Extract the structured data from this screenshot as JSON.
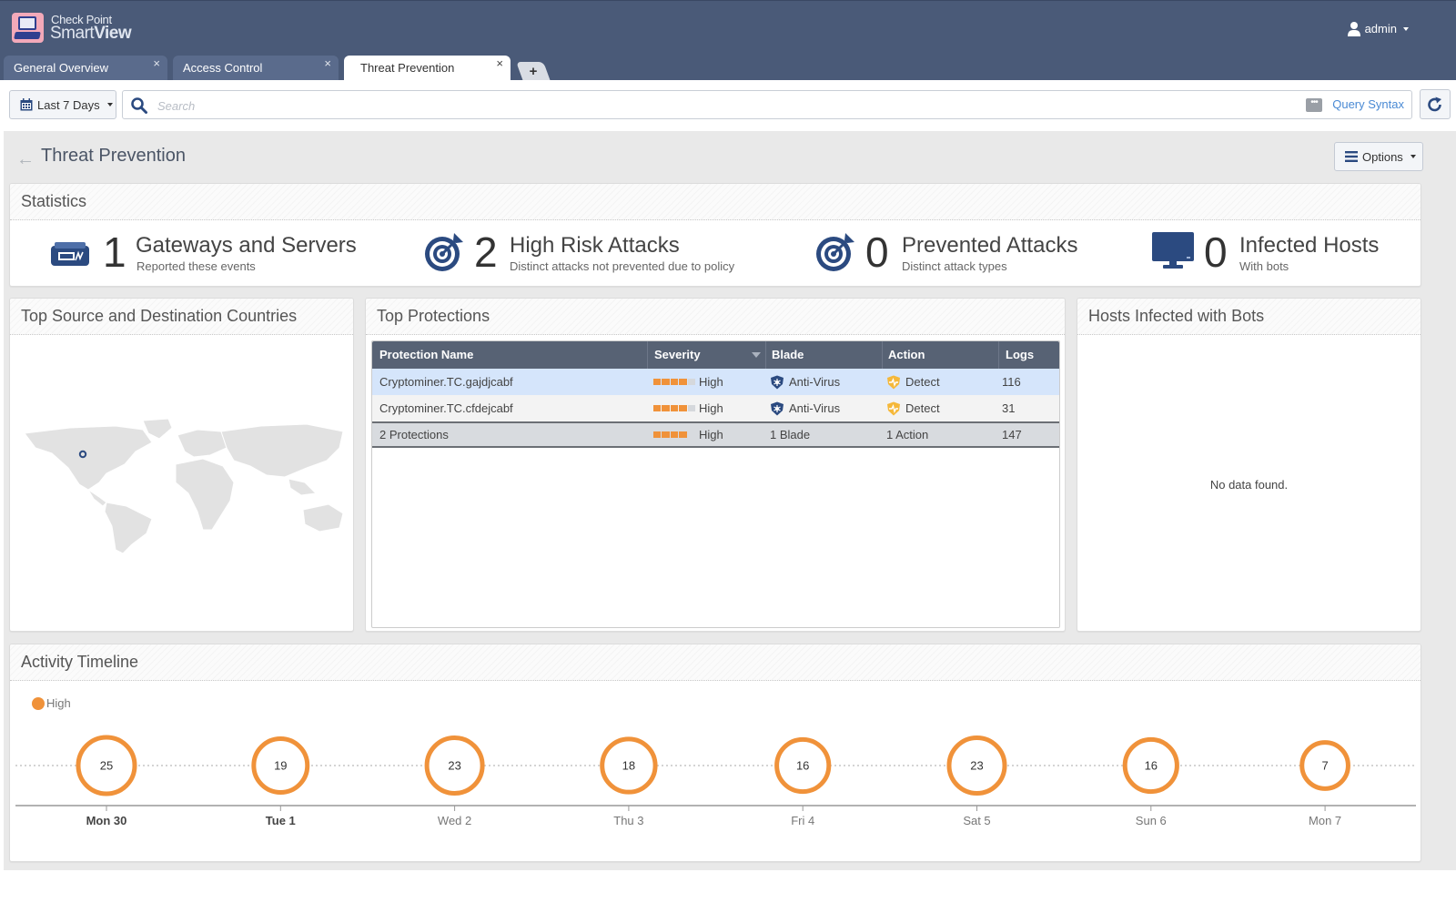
{
  "app": {
    "brand_line1": "Check Point",
    "brand_line2_light": "Smart",
    "brand_line2_bold": "View",
    "user": "admin",
    "logo_icon": "smartview-monitor-logo"
  },
  "tabs": [
    {
      "label": "General Overview",
      "active": false
    },
    {
      "label": "Access Control",
      "active": false
    },
    {
      "label": "Threat Prevention",
      "active": true
    }
  ],
  "tab_close_glyph": "×",
  "tab_add_glyph": "+",
  "toolbar": {
    "date_range": "Last 7 Days",
    "search_placeholder": "Search",
    "search_value": "",
    "query_syntax": "Query Syntax",
    "query_icon_glyph": "•••"
  },
  "page": {
    "title": "Threat Prevention",
    "back_glyph": "←",
    "options_label": "Options"
  },
  "statistics": {
    "title": "Statistics",
    "items": [
      {
        "icon": "gateway-icon",
        "value": "1",
        "label": "Gateways and Servers",
        "sub": "Reported these events"
      },
      {
        "icon": "target-icon",
        "value": "2",
        "label": "High Risk Attacks",
        "sub": "Distinct attacks not prevented due to policy"
      },
      {
        "icon": "target-icon",
        "value": "0",
        "label": "Prevented Attacks",
        "sub": "Distinct attack types"
      },
      {
        "icon": "monitor-icon",
        "value": "0",
        "label": "Infected Hosts",
        "sub": "With bots"
      }
    ]
  },
  "countries_panel": {
    "title": "Top Source and Destination Countries",
    "marker_location": "United States (West)"
  },
  "protections_panel": {
    "title": "Top Protections",
    "columns": [
      "Protection Name",
      "Severity",
      "Blade",
      "Action",
      "Logs"
    ],
    "sorted_column": "Severity",
    "rows": [
      {
        "name": "Cryptominer.TC.gajdjcabf",
        "severity": "High",
        "severity_level": 4,
        "severity_max": 5,
        "blade": "Anti-Virus",
        "action": "Detect",
        "logs": "116",
        "selected": true
      },
      {
        "name": "Cryptominer.TC.cfdejcabf",
        "severity": "High",
        "severity_level": 4,
        "severity_max": 5,
        "blade": "Anti-Virus",
        "action": "Detect",
        "logs": "31",
        "selected": false
      }
    ],
    "total": {
      "name": "2 Protections",
      "severity": "High",
      "severity_level": 4,
      "severity_max": 5,
      "blade": "1 Blade",
      "action": "1 Action",
      "logs": "147"
    }
  },
  "bots_panel": {
    "title": "Hosts Infected with Bots",
    "empty_text": "No data found."
  },
  "timeline": {
    "title": "Activity Timeline",
    "legend": [
      {
        "label": "High",
        "color": "#f0923a"
      }
    ]
  },
  "chart_data": {
    "type": "scatter",
    "title": "Activity Timeline",
    "series": [
      {
        "name": "High",
        "color": "#f0923a",
        "values": [
          25,
          19,
          23,
          18,
          16,
          23,
          16,
          7
        ]
      }
    ],
    "categories": [
      "Mon 30",
      "Tue 1",
      "Wed 2",
      "Thu 3",
      "Fri 4",
      "Sat 5",
      "Sun 6",
      "Mon 7"
    ],
    "bold_categories": [
      "Mon 30",
      "Tue 1"
    ],
    "encoding": "bubble size proportional to value",
    "xlabel": "",
    "ylabel": "",
    "grid": false,
    "legend_position": "top-left"
  },
  "colors": {
    "header": "#4a5a78",
    "accent_orange": "#f0923a",
    "table_header": "#576274",
    "selected_row": "#d5e5fb",
    "link": "#4a8ad4",
    "icon_navy": "#2b4a80"
  }
}
